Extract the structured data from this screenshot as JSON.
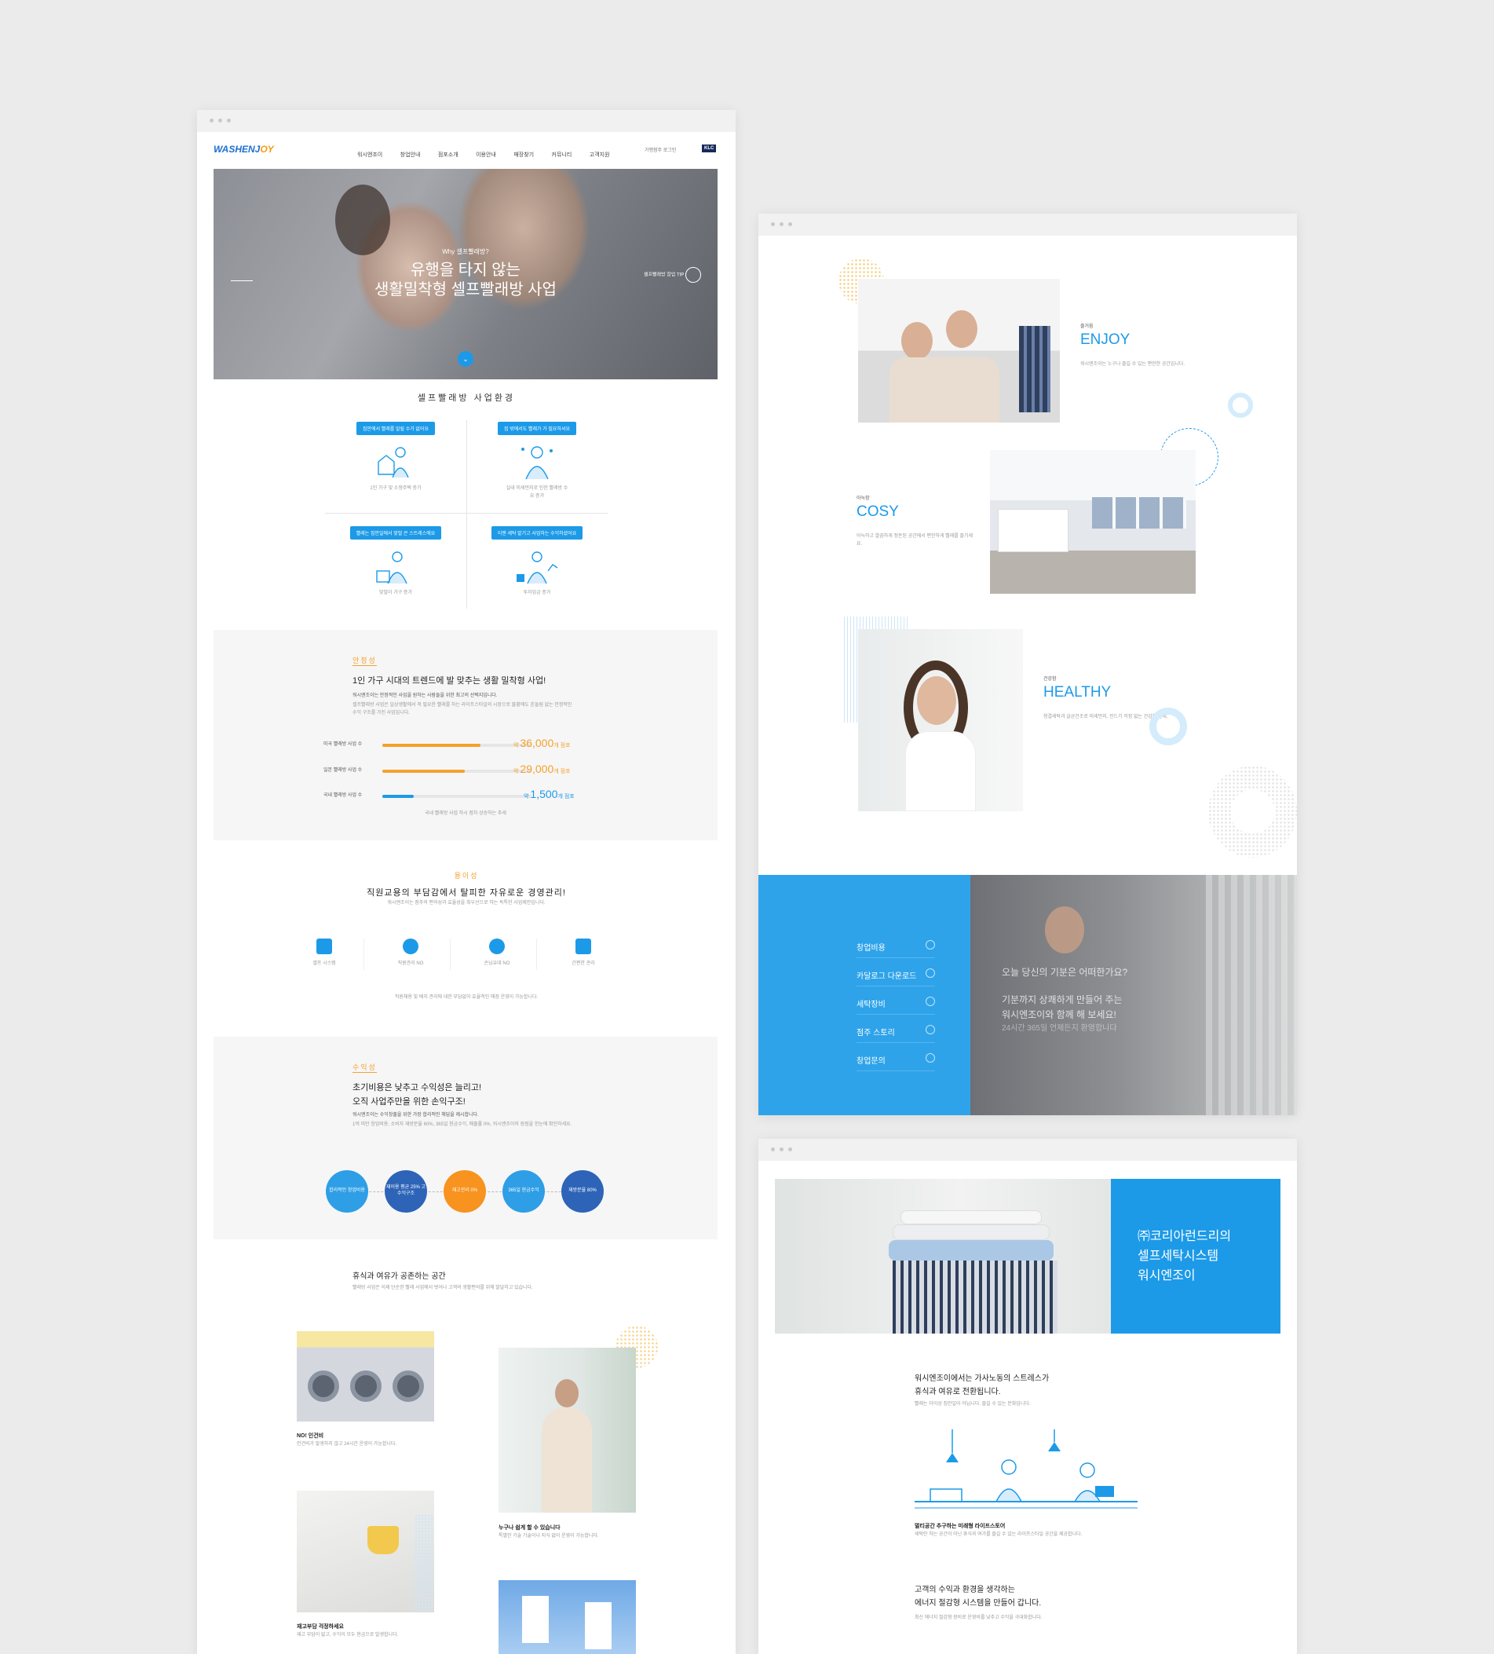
{
  "page1": {
    "header": {
      "logo_main": "WASHENJ",
      "logo_accent": "OY",
      "nav": [
        "워시엔조이",
        "창업안내",
        "점포소개",
        "이용안내",
        "매장찾기",
        "커뮤니티",
        "고객지원"
      ],
      "util": "가맹점주 로그인",
      "badge": "KLC"
    },
    "hero": {
      "eyebrow": "Why 셀프빨래방?",
      "title1": "유행을 타지 않는",
      "title2": "생활밀착형 셀프빨래방 사업",
      "right_link": "셀프빨래방 창업 TIP"
    },
    "env": {
      "title": "셀프빨래방 사업환경",
      "cards": [
        {
          "tag": "집안에서 빨래를 말릴 수가 없어요",
          "caption": "1인 가구 및 소형주택 증가"
        },
        {
          "tag": "집 밖에서도 빨래가 가 필요하셔요",
          "caption": "실내 미세먼지로 인한 빨래방 수요 증가"
        },
        {
          "tag": "빨래는 집안일에서 맞벌 큰 스트레스에요",
          "caption": "맞벌이 가구 증가"
        },
        {
          "tag": "이젠 세탁 맡기고 사업하는 수익하셨어요",
          "caption": "투자업금 증가"
        }
      ]
    },
    "stability": {
      "label": "안정성",
      "title": "1인 가구 시대의 트렌드에 발 맞추는 생활 밀착형 사업!",
      "subtitle": "워시엔조이는 안정적인 사업을 원하는 사람들을 위한 최고의 선택지입니다.",
      "body": "셀프빨래방 사업은 일상생활에서 꼭 필요한 빨래를 하는 라이프스타일의 시장으로 불황에도 흔들림 없는 안정적인 수익 구조를 가진 사업입니다.",
      "bars": [
        {
          "label": "미국 빨래방 사업 수",
          "prefix": "약",
          "value": "36,000",
          "unit": "개 점포",
          "level": 0.66,
          "color": "#f4a12a"
        },
        {
          "label": "일본 빨래방 사업 수",
          "prefix": "약",
          "value": "29,000",
          "unit": "개 점포",
          "level": 0.55,
          "color": "#f4a12a"
        },
        {
          "label": "국내 빨래방 사업 수",
          "prefix": "약",
          "value": "1,500",
          "unit": "개 점포",
          "level": 0.21,
          "color": "#1c9ae8"
        }
      ],
      "note": "국내 빨래방 사업 하시 점차 상승하는 추세"
    },
    "convenience": {
      "label": "용이성",
      "title": "직원교용의 부담감에서 탈피한 자유로운 경영관리!",
      "subtitle": "워시엔조이는 점주의 편의성과 효율성을 최우선으로 하는 독특한 사업제안입니다.",
      "icons": [
        "셀프 시스템",
        "직원관리 NO",
        "손님유대 NO",
        "간편한 관리"
      ],
      "body": "직원채용 및 배치 관리에 대한 부담없이 효율적인 매장 운영이 가능합니다."
    },
    "profit": {
      "label": "수익성",
      "title1": "초기비용은 낮추고 수익성은 늘리고!",
      "title2": "오직 사업주만을 위한 손익구조!",
      "subtitle": "워시엔조이는 수익창출을 위한 가장 합리적인 해답을 제시합니다.",
      "body": "1억 미만 창업비용, 소비자 재방문율 60%, 365일 현금수익, 매출률 0%, 워시엔조이의 장점을 한눈에 확인하세요.",
      "circles": [
        {
          "text": "합리적인 창업비용",
          "color": "#2e9ee6"
        },
        {
          "text": "재이용 평균 25% 고수익구조",
          "color": "#2d64b8"
        },
        {
          "text": "재고관리 0%",
          "color": "#f7931e"
        },
        {
          "text": "365일 현금수익",
          "color": "#2e9ee6"
        },
        {
          "text": "재방문율 80%",
          "color": "#2d64b8"
        }
      ]
    },
    "space": {
      "title": "휴식과 여유가 공존하는 공간",
      "body": "빨래방 사업은 이제 단순한 빨래 사업에서 벗어나 고객의 생활편의를 위해 발달하고 있습니다.",
      "items": [
        {
          "title": "NO! 인건비",
          "desc": "인건비가 발생하지 않고 24시간 운영이 가능합니다."
        },
        {
          "title": "누구나 쉽게 할 수 있습니다",
          "desc": "특별한 기술 기술이나 지식 없이 운영이 가능합니다."
        },
        {
          "title": "재고부담 걱정하세요",
          "desc": "재고 부담이 없고, 수익이 모두 현금으로 발생합니다."
        }
      ]
    }
  },
  "page2": {
    "features": [
      {
        "ko": "즐거움",
        "en": "ENJOY",
        "desc": "워시엔조이는 누구나 즐길 수 있는 편안한 공간입니다."
      },
      {
        "ko": "아늑함",
        "en": "COSY",
        "desc": "아늑하고 깔끔하게 정돈된 공간에서 편안하게 빨래를 즐기세요."
      },
      {
        "ko": "건강함",
        "en": "HEALTHY",
        "desc": "청결세탁과 살균건조로 미세먼지, 진드기 걱정 없는 건강한 빨래."
      }
    ],
    "menu": [
      "창업비용",
      "카달로그 다운로드",
      "세탁장비",
      "점주 스토리",
      "창업문의"
    ],
    "banner": {
      "q": "오늘 당신의 기분은 어떠한가요?",
      "l1": "기분까지 상쾌하게 만들어 주는",
      "l2": "워시엔조이와 함께 해 보세요!",
      "l3": "24시간 365일 언제든지 환영합니다"
    }
  },
  "page3": {
    "hero": {
      "l1": "㈜코리아런드리의",
      "l2": "셀프세탁시스템",
      "l3": "워시엔조이"
    },
    "sec1": {
      "t1": "워시엔조이에서는 가사노동의 스트레스가",
      "t2": "휴식과 여유로 전환됩니다.",
      "body": "빨래는 더이상 집안일이 아닙니다. 즐길 수 있는 문화입니다.",
      "sub": "멀티공간 추구하는 미래형 라이프스토어",
      "subdesc": "세탁만 하는 공간이 아닌 휴식과 여가를 즐길 수 있는 라이프스타일 공간을 제공합니다."
    },
    "sec2": {
      "t1": "고객의 수익과 환경을 생각하는",
      "t2": "에너지 절감형 시스템을 만들어 갑니다.",
      "body": "최신 에너지 절감형 장비로 운영비를 낮추고 수익을 극대화합니다."
    }
  },
  "colors": {
    "blue": "#1c9ae8",
    "orange": "#f4a12a",
    "bg": "#ebebec"
  }
}
